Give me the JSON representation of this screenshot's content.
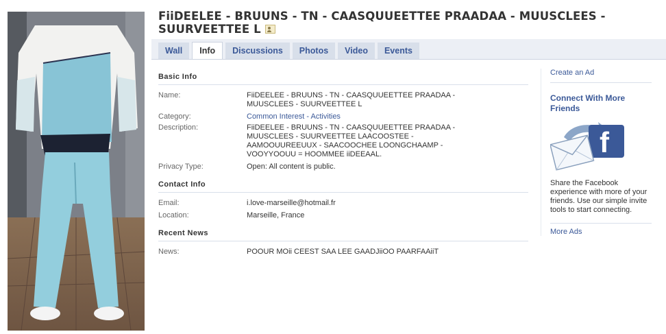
{
  "profile": {
    "title": "FiiDEELEE - BRUUNS - TN - CAASQUUEETTEE PRAADAA - MUUSCLEES - SUURVEETTEE L",
    "photo_icon": "person-figure-photo"
  },
  "tabs": [
    {
      "label": "Wall",
      "active": false
    },
    {
      "label": "Info",
      "active": true
    },
    {
      "label": "Discussions",
      "active": false
    },
    {
      "label": "Photos",
      "active": false
    },
    {
      "label": "Video",
      "active": false
    },
    {
      "label": "Events",
      "active": false
    }
  ],
  "basic_info": {
    "heading": "Basic Info",
    "name_label": "Name:",
    "name_value": "FiiDEELEE - BRUUNS - TN - CAASQUUEETTEE PRAADAA - MUUSCLEES - SUURVEETTEE L",
    "category_label": "Category:",
    "category_value": "Common Interest - Activities",
    "description_label": "Description:",
    "description_value": "FiiDEELEE - BRUUNS - TN - CAASQUUEETTEE PRAADAA - MUUSCLEES - SUURVEETTEE LAACOOSTEE - AAMOOUUREEUUX - SAACOOCHEE LOONGCHAAMP - VOOYYOOUU = HOOMMEE iiDEEAAL.",
    "privacy_label": "Privacy Type:",
    "privacy_value": "Open: All content is public."
  },
  "contact_info": {
    "heading": "Contact Info",
    "email_label": "Email:",
    "email_value": "i.love-marseille@hotmail.fr",
    "location_label": "Location:",
    "location_value": "Marseille, France"
  },
  "recent_news": {
    "heading": "Recent News",
    "news_label": "News:",
    "news_value": "POOUR MOii CEEST SAA LEE GAADJiiOO PAARFAAiiT"
  },
  "sidebar": {
    "create_ad": "Create an Ad",
    "connect_title": "Connect With More Friends",
    "ad_text": "Share the Facebook experience with more of your friends. Use our simple invite tools to start connecting.",
    "more_ads": "More Ads"
  },
  "colors": {
    "link": "#3b5998",
    "tab_bg": "#d8dfea",
    "header_band": "#eceff5"
  }
}
